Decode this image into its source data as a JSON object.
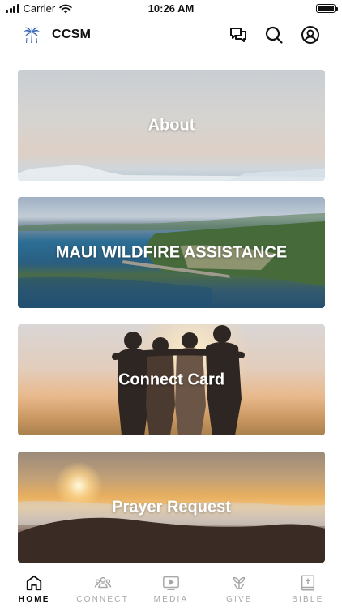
{
  "status_bar": {
    "carrier": "Carrier",
    "time": "10:26 AM"
  },
  "header": {
    "title": "CCSM",
    "icons": [
      "palm-tree-logo",
      "chat-icon",
      "search-icon",
      "profile-icon"
    ]
  },
  "cards": [
    {
      "label": "About"
    },
    {
      "label": "MAUI WILDFIRE ASSISTANCE"
    },
    {
      "label": "Connect Card"
    },
    {
      "label": "Prayer Request"
    }
  ],
  "tabs": [
    {
      "label": "HOME",
      "icon": "home-icon",
      "active": true
    },
    {
      "label": "CONNECT",
      "icon": "people-icon",
      "active": false
    },
    {
      "label": "MEDIA",
      "icon": "play-icon",
      "active": false
    },
    {
      "label": "GIVE",
      "icon": "plant-icon",
      "active": false
    },
    {
      "label": "BIBLE",
      "icon": "bible-icon",
      "active": false
    }
  ],
  "colors": {
    "accent": "#2f5fb3",
    "active_tab": "#111111",
    "inactive_tab": "#a7a7a7"
  }
}
